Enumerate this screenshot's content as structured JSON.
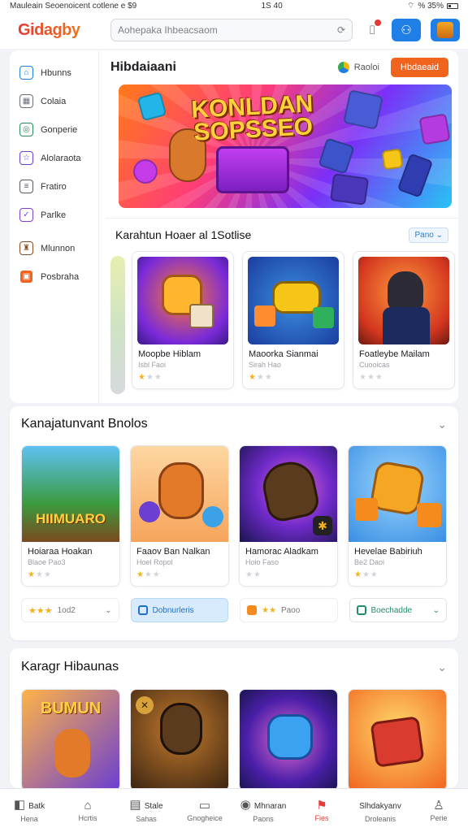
{
  "status_bar": {
    "left": "Mauleain Seoenoicent cotlene e $9",
    "time": "1S 40",
    "right": "% 35%"
  },
  "header": {
    "logo": "Gidagby",
    "search_placeholder": "Aohepaka Ihbeacsaom",
    "icons": [
      "notifications-icon",
      "friends-icon",
      "profile-avatar"
    ]
  },
  "sidebar": {
    "items": [
      {
        "label": "Hbunns",
        "icon": "home-icon",
        "color": "#1f7fe6"
      },
      {
        "label": "Colaia",
        "icon": "grid-icon",
        "color": "#6b6f78"
      },
      {
        "label": "Gonperie",
        "icon": "controller-icon",
        "color": "#2e8b57"
      },
      {
        "label": "Alolaraota",
        "icon": "star-icon",
        "color": "#6a3fd1"
      },
      {
        "label": "Fratiro",
        "icon": "list-icon",
        "color": "#555a63"
      },
      {
        "label": "Parlke",
        "icon": "check-icon",
        "color": "#7b3fd1"
      },
      {
        "label": "Mlunnon",
        "icon": "trophy-icon",
        "color": "#8a4b22"
      },
      {
        "label": "Posbraha",
        "icon": "gift-icon",
        "color": "#f1641e"
      }
    ]
  },
  "main": {
    "title": "Hibdaiaani",
    "sort_label": "Raoloi",
    "cta_label": "Hbdaeaid",
    "banner_title": [
      "KONLDAN",
      "SOPSSEO"
    ]
  },
  "featured": {
    "title": "Karahtun Hoaer al 1Sotlise",
    "filter_label": "Pano",
    "games": [
      {
        "name": "Moopbe Hiblam",
        "sub": "Isbl Faoi",
        "rating": 1
      },
      {
        "name": "Maoorka Sianmai",
        "sub": "Sirah Hao",
        "rating": 1
      },
      {
        "name": "Foatleybe Mailam",
        "sub": "Cuooicas",
        "rating": 0
      }
    ]
  },
  "section2": {
    "title": "Kanajatunvant Bnolos",
    "games": [
      {
        "name": "Hoiaraa Hoakan",
        "sub": "Blaoe Pao3",
        "rating": 1,
        "art_text": "HIIMUARO"
      },
      {
        "name": "Faaov Ban Nalkan",
        "sub": "Hoel Ropol",
        "rating": 1,
        "art_text": ""
      },
      {
        "name": "Hamorac Aladkam",
        "sub": "Hoio Faso",
        "rating": 0,
        "art_text": ""
      },
      {
        "name": "Hevelae Babiriuh",
        "sub": "Be2 Daoi",
        "rating": 1,
        "art_text": ""
      }
    ],
    "actions": [
      {
        "label": "1od2",
        "style": "plain"
      },
      {
        "label": "Dobnurleris",
        "style": "blue"
      },
      {
        "label": "Paoo",
        "style": "plain"
      },
      {
        "label": "Boechadde",
        "style": "green"
      }
    ]
  },
  "section3": {
    "title": "Karagr Hibaunas",
    "games": [
      {
        "art_text": "BUMUN"
      },
      {
        "art_text": ""
      },
      {
        "art_text": ""
      },
      {
        "art_text": ""
      }
    ]
  },
  "tabbar": {
    "tabs": [
      {
        "label": "Batk",
        "sub": "Hena",
        "icon": "back-icon",
        "active": false
      },
      {
        "label": "",
        "sub": "Hcrtis",
        "icon": "home-icon",
        "active": false
      },
      {
        "label": "Stale",
        "sub": "Sahas",
        "icon": "store-icon",
        "active": false
      },
      {
        "label": "",
        "sub": "Gnogheice",
        "icon": "library-icon",
        "active": false
      },
      {
        "label": "Mhnaran",
        "sub": "Paons",
        "icon": "games-icon",
        "active": false
      },
      {
        "label": "",
        "sub": "Fies",
        "icon": "hot-icon",
        "active": true
      },
      {
        "label": "Slhdakyanv",
        "sub": "Droleanis",
        "icon": "chat-icon",
        "active": false
      },
      {
        "label": "",
        "sub": "Perie",
        "icon": "profile-icon",
        "active": false
      }
    ]
  },
  "colors": {
    "accent_orange": "#f1641e",
    "accent_blue": "#1f7fe6",
    "star": "#f5b01c",
    "active_tab": "#e53935"
  }
}
